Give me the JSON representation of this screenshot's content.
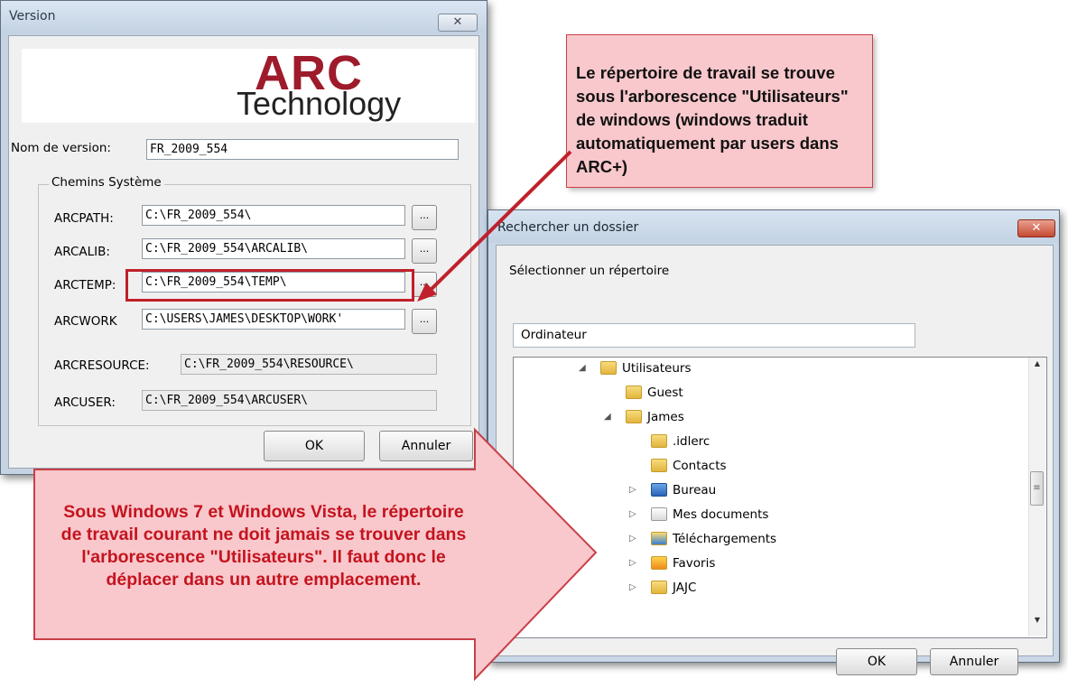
{
  "version_dialog": {
    "title": "Version",
    "close_glyph": "✕",
    "logo": {
      "line1": "ARC",
      "line2": "Technology"
    },
    "version_name_label": "Nom de version:",
    "version_name_value": "FR_2009_554",
    "group_label": "Chemins Système",
    "browse_label": "...",
    "paths": [
      {
        "label": "ARCPATH:",
        "value": "C:\\FR_2009_554\\"
      },
      {
        "label": "ARCALIB:",
        "value": "C:\\FR_2009_554\\ARCALIB\\"
      },
      {
        "label": "ARCTEMP:",
        "value": "C:\\FR_2009_554\\TEMP\\"
      },
      {
        "label": "ARCWORK",
        "value": "C:\\USERS\\JAMES\\DESKTOP\\WORK'"
      },
      {
        "label": "ARCRESOURCE:",
        "value": "C:\\FR_2009_554\\RESOURCE\\"
      },
      {
        "label": "ARCUSER:",
        "value": "C:\\FR_2009_554\\ARCUSER\\"
      }
    ],
    "ok_label": "OK",
    "cancel_label": "Annuler"
  },
  "callout_top": {
    "text": "Le répertoire de travail se trouve sous l'arborescence \"Utilisateurs\" de windows (windows traduit automatiquement par users dans ARC+)"
  },
  "callout_bottom": {
    "text": "Sous Windows 7 et Windows Vista, le répertoire de travail courant ne doit jamais se trouver dans l'arborescence \"Utilisateurs\". Il faut donc le déplacer dans un autre emplacement."
  },
  "browse_dialog": {
    "title": "Rechercher un dossier",
    "close_glyph": "✕",
    "prompt": "Sélectionner un répertoire",
    "path_value": "Ordinateur",
    "tree": [
      {
        "label": "Utilisateurs",
        "arrow": "◢",
        "icon": "folder-icon"
      },
      {
        "label": "Guest",
        "arrow": "",
        "icon": "folder-icon"
      },
      {
        "label": "James",
        "arrow": "◢",
        "icon": "folder-icon"
      },
      {
        "label": ".idlerc",
        "arrow": "",
        "icon": "folder-icon"
      },
      {
        "label": "Contacts",
        "arrow": "",
        "icon": "contacts-folder-icon"
      },
      {
        "label": "Bureau",
        "arrow": "▷",
        "icon": "desktop-folder-icon"
      },
      {
        "label": "Mes documents",
        "arrow": "▷",
        "icon": "documents-folder-icon"
      },
      {
        "label": "Téléchargements",
        "arrow": "▷",
        "icon": "downloads-folder-icon"
      },
      {
        "label": "Favoris",
        "arrow": "▷",
        "icon": "favorites-folder-icon"
      },
      {
        "label": "JAJC",
        "arrow": "▷",
        "icon": "folder-icon"
      }
    ],
    "scroll_up_glyph": "▲",
    "scroll_down_glyph": "▼",
    "scroll_thumb_glyph": "≡",
    "ok_label": "OK",
    "cancel_label": "Annuler"
  },
  "colors": {
    "callout_fill": "#f9c8cc",
    "callout_border": "#c84048",
    "arrow_red": "#c0202b",
    "logo_red": "#9e1b2b"
  }
}
